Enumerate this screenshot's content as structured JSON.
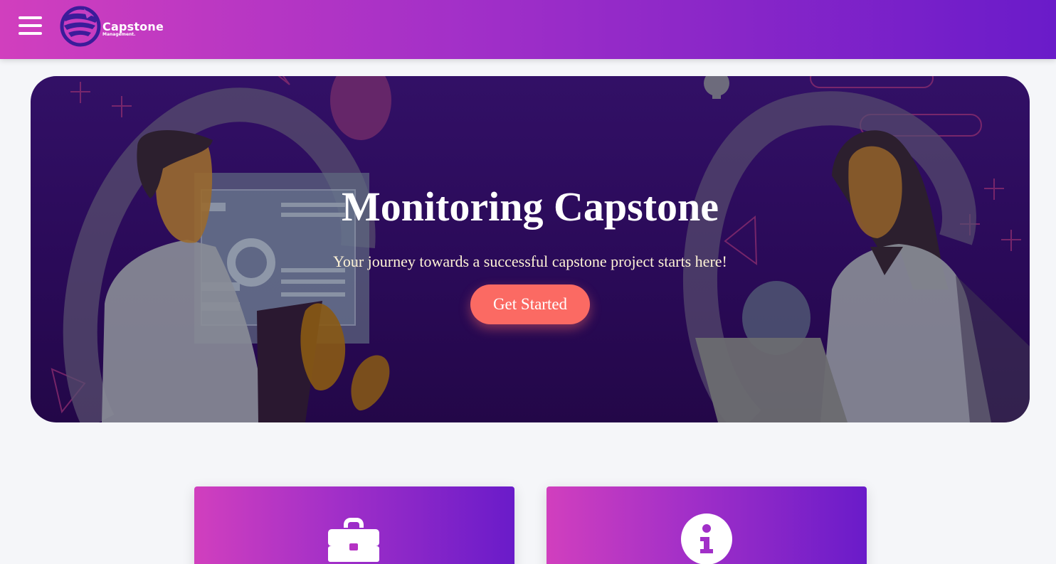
{
  "header": {
    "menu_icon": "hamburger-menu-icon",
    "logo": {
      "title": "Capstone",
      "subtitle": "Management."
    }
  },
  "hero": {
    "title": "Monitoring Capstone",
    "subtitle": "Your journey towards a successful capstone project starts here!",
    "cta_label": "Get Started"
  },
  "cards": [
    {
      "icon": "briefcase-icon"
    },
    {
      "icon": "info-circle-icon"
    }
  ],
  "colors": {
    "header_gradient": [
      "#d13fbe",
      "#6a1bc9"
    ],
    "hero_background": "#2a0a58",
    "cta": "#fb6a63",
    "page_background": "#f5f6f9"
  }
}
